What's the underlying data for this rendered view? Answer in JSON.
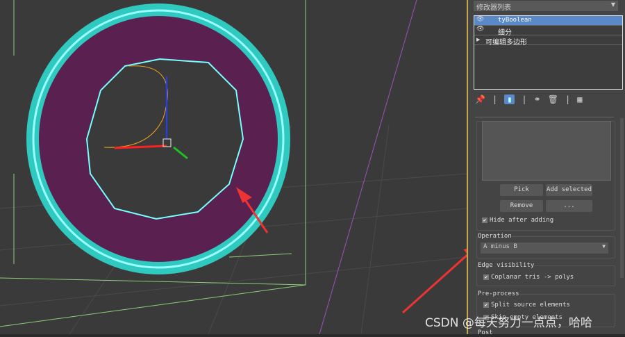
{
  "modifier_list": {
    "label": "修改器列表",
    "items": [
      {
        "label": "tyBoolean",
        "selected": true,
        "eye": true
      },
      {
        "label": "细分",
        "eye": true
      },
      {
        "label": "可编辑多边形",
        "expandable": true
      }
    ]
  },
  "toolbar": {
    "icons": [
      "pin-icon",
      "show-end-result-icon",
      "make-unique-icon",
      "remove-modifier-icon",
      "configure-icon"
    ]
  },
  "operands": {
    "pick": "Pick",
    "add_selected": "Add selected",
    "remove": "Remove",
    "more": "...",
    "hide_after_adding": "Hide after adding"
  },
  "operation": {
    "label": "Operation",
    "value": "A minus B"
  },
  "edge_visibility": {
    "label": "Edge visibility",
    "coplanar": "Coplanar tris -> polys"
  },
  "preprocess": {
    "label": "Pre-process",
    "split": "Split source elements",
    "skip": "Skip empty elements"
  },
  "post": {
    "label": "Post"
  },
  "watermark": "CSDN @每天努力一点点，哈哈",
  "colors": {
    "accent": "#5b88c6",
    "ring": "#2fc9c0",
    "disc": "#5a2050",
    "arrow": "#e83a3a"
  }
}
